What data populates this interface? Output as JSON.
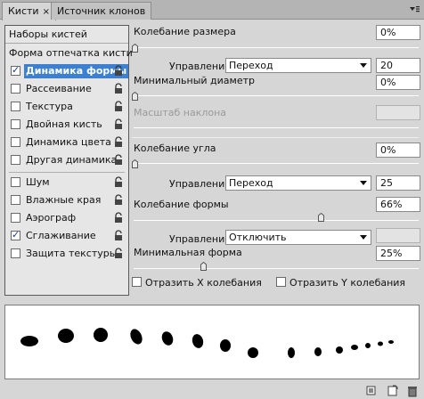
{
  "tabs": [
    {
      "label": "Кисти",
      "close": "×",
      "active": true
    },
    {
      "label": "Источник клонов",
      "active": false
    }
  ],
  "sidebar": {
    "presets": "Наборы кистей",
    "tip_shape": "Форма отпечатка кисти",
    "items": [
      {
        "label": "Динамика формы",
        "checked": true,
        "selected": true
      },
      {
        "label": "Рассеивание",
        "checked": false
      },
      {
        "label": "Текстура",
        "checked": false
      },
      {
        "label": "Двойная кисть",
        "checked": false
      },
      {
        "label": "Динамика цвета",
        "checked": false
      },
      {
        "label": "Другая динамика",
        "checked": false
      },
      {
        "label": "Шум",
        "checked": false
      },
      {
        "label": "Влажные края",
        "checked": false
      },
      {
        "label": "Аэрограф",
        "checked": false
      },
      {
        "label": "Сглаживание",
        "checked": true
      },
      {
        "label": "Защита текстуры",
        "checked": false
      }
    ]
  },
  "settings": {
    "size_jitter": {
      "label": "Колебание размера",
      "value": "0%"
    },
    "size_control": {
      "label": "Управление:",
      "selected": "Переход",
      "value": "20"
    },
    "min_diameter": {
      "label": "Минимальный диаметр",
      "value": "0%"
    },
    "tilt_scale": {
      "label": "Масштаб наклона",
      "value": ""
    },
    "angle_jitter": {
      "label": "Колебание угла",
      "value": "0%"
    },
    "angle_control": {
      "label": "Управление:",
      "selected": "Переход",
      "value": "25"
    },
    "roundness_jitter": {
      "label": "Колебание формы",
      "value": "66%"
    },
    "roundness_control": {
      "label": "Управление:",
      "selected": "Отключить",
      "value": ""
    },
    "min_roundness": {
      "label": "Минимальная форма",
      "value": "25%"
    },
    "flip_x": {
      "label": "Отразить X колебания",
      "checked": false
    },
    "flip_y": {
      "label": "Отразить Y колебания",
      "checked": false
    }
  },
  "icons": {
    "panel_menu": "panel-menu-icon",
    "lock": "lock-icon",
    "brush_library": "brush-library-icon",
    "new_brush": "new-brush-icon",
    "delete": "trash-icon"
  }
}
